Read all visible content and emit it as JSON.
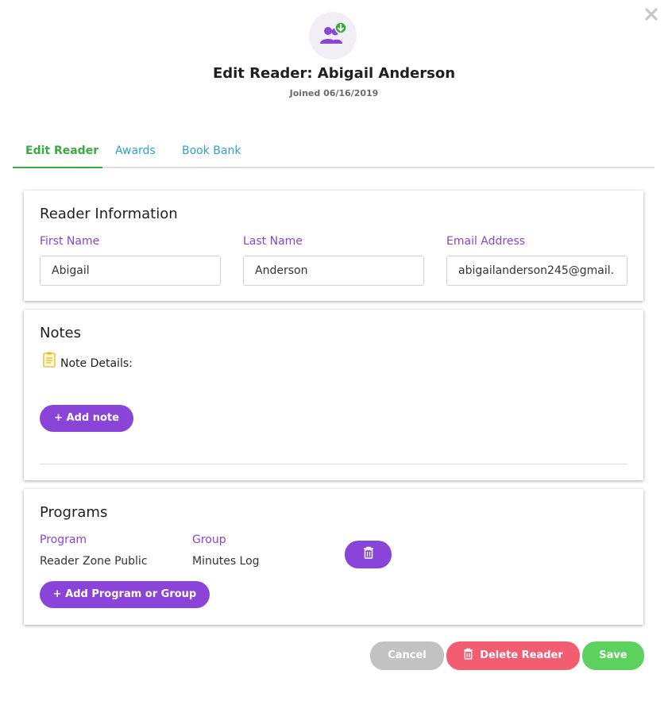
{
  "header": {
    "title": "Edit Reader: Abigail Anderson",
    "joined": "Joined 06/16/2019"
  },
  "tabs": [
    {
      "label": "Edit Reader",
      "active": true
    },
    {
      "label": "Awards",
      "active": false
    },
    {
      "label": "Book Bank",
      "active": false
    }
  ],
  "reader_info": {
    "heading": "Reader Information",
    "first_name_label": "First Name",
    "first_name_value": "Abigail",
    "last_name_label": "Last Name",
    "last_name_value": "Anderson",
    "email_label": "Email Address",
    "email_value": "abigailanderson245@gmail."
  },
  "notes": {
    "heading": "Notes",
    "details_label": "Note Details:",
    "add_note_label": "+ Add note"
  },
  "programs": {
    "heading": "Programs",
    "program_col": "Program",
    "group_col": "Group",
    "rows": [
      {
        "program": "Reader Zone Public",
        "group": "Minutes Log"
      }
    ],
    "add_label": "+ Add Program or Group"
  },
  "footer": {
    "cancel_label": "Cancel",
    "delete_label": "Delete Reader",
    "save_label": "Save"
  },
  "colors": {
    "purple": "#8b44d8",
    "green": "#3aab3f",
    "teal": "#2ea3c4",
    "red": "#f25d72",
    "save_green": "#5dd15d",
    "gray": "#c2c2c2"
  }
}
